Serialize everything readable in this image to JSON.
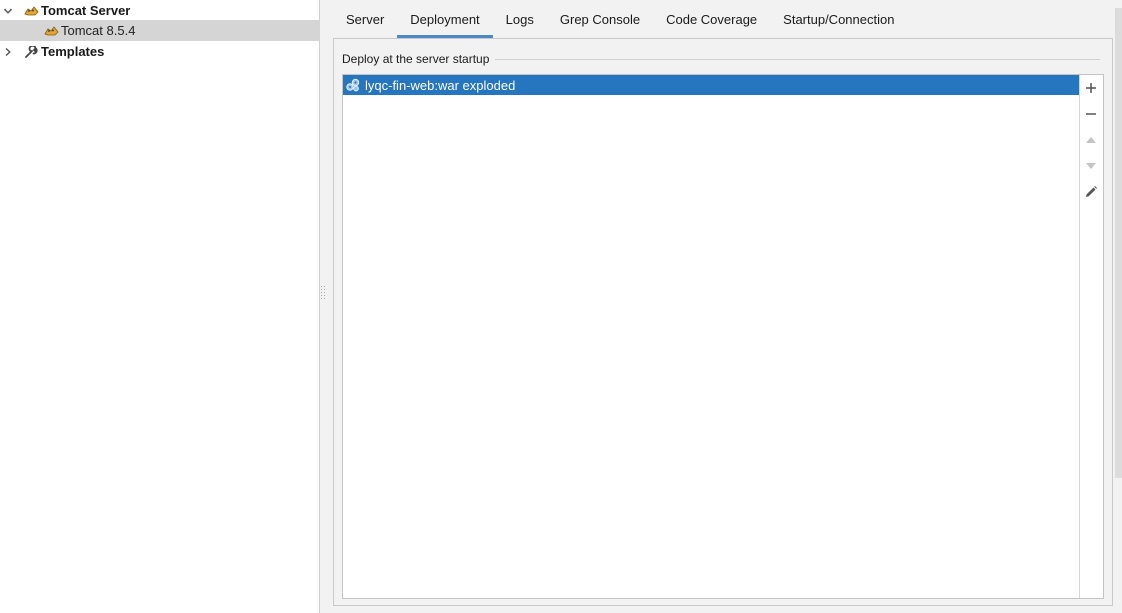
{
  "tree": {
    "items": [
      {
        "label": "Tomcat Server",
        "expanded": true,
        "bold": true,
        "icon": "tomcat-icon"
      },
      {
        "label": "Tomcat 8.5.4",
        "selected": true,
        "icon": "tomcat-icon"
      },
      {
        "label": "Templates",
        "expanded": false,
        "bold": true,
        "icon": "wrench-icon"
      }
    ]
  },
  "tabs": [
    {
      "label": "Server"
    },
    {
      "label": "Deployment",
      "active": true
    },
    {
      "label": "Logs"
    },
    {
      "label": "Grep Console"
    },
    {
      "label": "Code Coverage"
    },
    {
      "label": "Startup/Connection"
    }
  ],
  "deployment": {
    "section_title": "Deploy at the server startup",
    "items": [
      {
        "label": "lyqc-fin-web:war exploded",
        "icon": "artifact-icon",
        "selected": true
      }
    ],
    "toolbar": {
      "add_icon": "plus-icon",
      "remove_icon": "minus-icon",
      "up_icon": "arrow-up-icon",
      "down_icon": "arrow-down-icon",
      "edit_icon": "pencil-icon"
    }
  },
  "colors": {
    "selection": "#2675bf",
    "tab_underline": "#4a88c7",
    "tree_selected": "#d5d5d5"
  }
}
